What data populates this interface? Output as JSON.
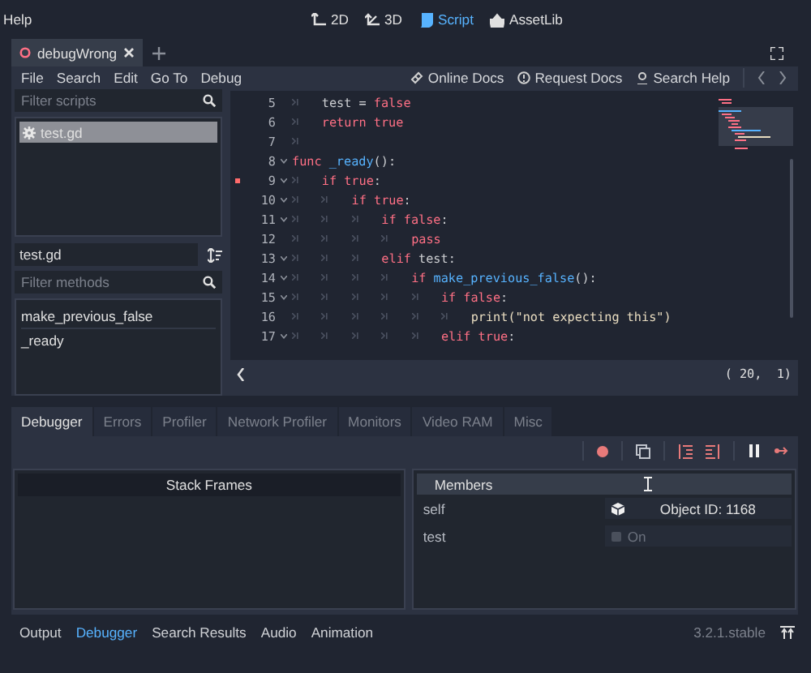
{
  "menu": {
    "items": [
      "Help"
    ]
  },
  "main_screens": [
    {
      "label": "2D",
      "kind": "plane",
      "selected": false
    },
    {
      "label": "3D",
      "kind": "space",
      "selected": false
    },
    {
      "label": "Script",
      "kind": "script",
      "selected": true
    },
    {
      "label": "AssetLib",
      "kind": "assetlib",
      "selected": false
    }
  ],
  "script_tabs": [
    {
      "label": "debugWrong",
      "selected": true
    }
  ],
  "script_menu": [
    "File",
    "Search",
    "Edit",
    "Go To",
    "Debug"
  ],
  "help_buttons": [
    {
      "label": "Online Docs",
      "kind": "online"
    },
    {
      "label": "Request Docs",
      "kind": "request"
    },
    {
      "label": "Search Help",
      "kind": "search"
    }
  ],
  "scripts_filter": {
    "placeholder": "Filter scripts"
  },
  "scripts": [
    {
      "name": "test.gd",
      "selected": true
    }
  ],
  "current_script": "test.gd",
  "methods_filter": {
    "placeholder": "Filter methods"
  },
  "methods": [
    "make_previous_false",
    "_ready"
  ],
  "code_lines": [
    {
      "number": "5",
      "foldable": false,
      "breakpoint": false,
      "tokens": [
        {
          "kind": "tab"
        },
        {
          "kind": "text",
          "text": "test = "
        },
        {
          "kind": "keyword",
          "text": "false"
        }
      ]
    },
    {
      "number": "6",
      "foldable": false,
      "breakpoint": false,
      "tokens": [
        {
          "kind": "tab"
        },
        {
          "kind": "keyword",
          "text": "return true"
        }
      ]
    },
    {
      "number": "7",
      "foldable": false,
      "breakpoint": false,
      "tokens": [
        {
          "kind": "tab"
        }
      ]
    },
    {
      "number": "8",
      "foldable": true,
      "breakpoint": false,
      "tokens": [
        {
          "kind": "keyword",
          "text": "func "
        },
        {
          "kind": "function",
          "text": "_ready"
        },
        {
          "kind": "text",
          "text": "():"
        }
      ]
    },
    {
      "number": "9",
      "foldable": true,
      "breakpoint": true,
      "tokens": [
        {
          "kind": "tab"
        },
        {
          "kind": "keyword",
          "text": "if true"
        },
        {
          "kind": "text",
          "text": ":"
        }
      ]
    },
    {
      "number": "10",
      "foldable": true,
      "breakpoint": false,
      "tokens": [
        {
          "kind": "tab"
        },
        {
          "kind": "tab"
        },
        {
          "kind": "keyword",
          "text": "if true"
        },
        {
          "kind": "text",
          "text": ":"
        }
      ]
    },
    {
      "number": "11",
      "foldable": true,
      "breakpoint": false,
      "tokens": [
        {
          "kind": "tab"
        },
        {
          "kind": "tab"
        },
        {
          "kind": "tab"
        },
        {
          "kind": "keyword",
          "text": "if false"
        },
        {
          "kind": "text",
          "text": ":"
        }
      ]
    },
    {
      "number": "12",
      "foldable": false,
      "breakpoint": false,
      "tokens": [
        {
          "kind": "tab"
        },
        {
          "kind": "tab"
        },
        {
          "kind": "tab"
        },
        {
          "kind": "tab"
        },
        {
          "kind": "keyword",
          "text": "pass"
        }
      ]
    },
    {
      "number": "13",
      "foldable": true,
      "breakpoint": false,
      "tokens": [
        {
          "kind": "tab"
        },
        {
          "kind": "tab"
        },
        {
          "kind": "tab"
        },
        {
          "kind": "keyword",
          "text": "elif "
        },
        {
          "kind": "text",
          "text": "test:"
        }
      ]
    },
    {
      "number": "14",
      "foldable": true,
      "breakpoint": false,
      "tokens": [
        {
          "kind": "tab"
        },
        {
          "kind": "tab"
        },
        {
          "kind": "tab"
        },
        {
          "kind": "tab"
        },
        {
          "kind": "keyword",
          "text": "if "
        },
        {
          "kind": "function",
          "text": "make_previous_false"
        },
        {
          "kind": "text",
          "text": "():"
        }
      ]
    },
    {
      "number": "15",
      "foldable": true,
      "breakpoint": false,
      "tokens": [
        {
          "kind": "tab"
        },
        {
          "kind": "tab"
        },
        {
          "kind": "tab"
        },
        {
          "kind": "tab"
        },
        {
          "kind": "tab"
        },
        {
          "kind": "keyword",
          "text": "if false"
        },
        {
          "kind": "text",
          "text": ":"
        }
      ]
    },
    {
      "number": "16",
      "foldable": false,
      "breakpoint": false,
      "tokens": [
        {
          "kind": "tab"
        },
        {
          "kind": "tab"
        },
        {
          "kind": "tab"
        },
        {
          "kind": "tab"
        },
        {
          "kind": "tab"
        },
        {
          "kind": "tab"
        },
        {
          "kind": "call",
          "text": "print(\"not expecting this\")"
        }
      ]
    },
    {
      "number": "17",
      "foldable": true,
      "breakpoint": false,
      "tokens": [
        {
          "kind": "tab"
        },
        {
          "kind": "tab"
        },
        {
          "kind": "tab"
        },
        {
          "kind": "tab"
        },
        {
          "kind": "tab"
        },
        {
          "kind": "keyword",
          "text": "elif true"
        },
        {
          "kind": "text",
          "text": ":"
        }
      ]
    }
  ],
  "cursor_position": "( 20,  1)",
  "debugger_tabs": [
    {
      "label": "Debugger",
      "selected": true
    },
    {
      "label": "Errors",
      "selected": false
    },
    {
      "label": "Profiler",
      "selected": false
    },
    {
      "label": "Network Profiler",
      "selected": false
    },
    {
      "label": "Monitors",
      "selected": false
    },
    {
      "label": "Video RAM",
      "selected": false
    },
    {
      "label": "Misc",
      "selected": false
    }
  ],
  "stack_frames": {
    "title": "Stack Frames"
  },
  "members": {
    "title": "Members",
    "rows": [
      {
        "name": "self",
        "kind": "object",
        "value": "Object ID: 1168"
      },
      {
        "name": "test",
        "kind": "bool",
        "checked": false,
        "value": "On"
      }
    ]
  },
  "bottom_tabs": [
    {
      "label": "Output",
      "selected": false
    },
    {
      "label": "Debugger",
      "selected": true
    },
    {
      "label": "Search Results",
      "selected": false
    },
    {
      "label": "Audio",
      "selected": false
    },
    {
      "label": "Animation",
      "selected": false
    }
  ],
  "version": "3.2.1.stable"
}
